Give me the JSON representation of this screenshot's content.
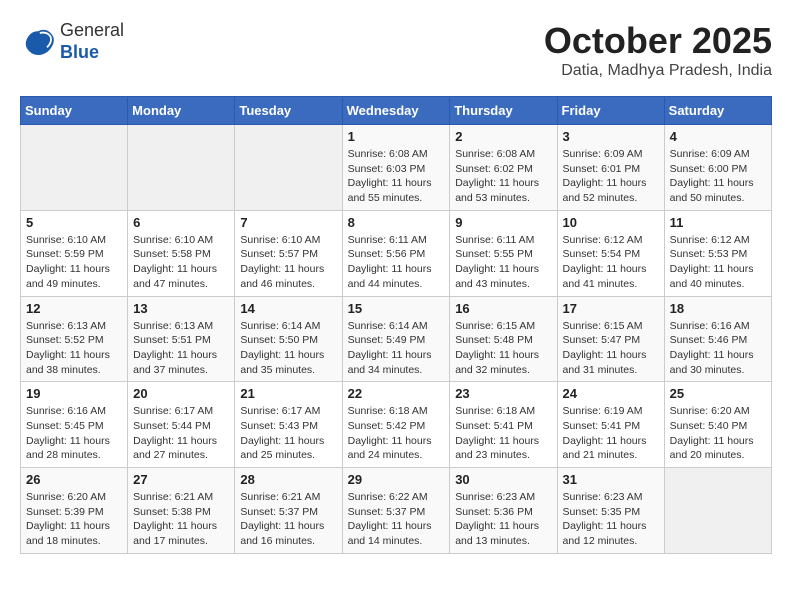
{
  "header": {
    "logo_line1": "General",
    "logo_line2": "Blue",
    "month": "October 2025",
    "location": "Datia, Madhya Pradesh, India"
  },
  "weekdays": [
    "Sunday",
    "Monday",
    "Tuesday",
    "Wednesday",
    "Thursday",
    "Friday",
    "Saturday"
  ],
  "weeks": [
    [
      {
        "day": "",
        "info": ""
      },
      {
        "day": "",
        "info": ""
      },
      {
        "day": "",
        "info": ""
      },
      {
        "day": "1",
        "info": "Sunrise: 6:08 AM\nSunset: 6:03 PM\nDaylight: 11 hours\nand 55 minutes."
      },
      {
        "day": "2",
        "info": "Sunrise: 6:08 AM\nSunset: 6:02 PM\nDaylight: 11 hours\nand 53 minutes."
      },
      {
        "day": "3",
        "info": "Sunrise: 6:09 AM\nSunset: 6:01 PM\nDaylight: 11 hours\nand 52 minutes."
      },
      {
        "day": "4",
        "info": "Sunrise: 6:09 AM\nSunset: 6:00 PM\nDaylight: 11 hours\nand 50 minutes."
      }
    ],
    [
      {
        "day": "5",
        "info": "Sunrise: 6:10 AM\nSunset: 5:59 PM\nDaylight: 11 hours\nand 49 minutes."
      },
      {
        "day": "6",
        "info": "Sunrise: 6:10 AM\nSunset: 5:58 PM\nDaylight: 11 hours\nand 47 minutes."
      },
      {
        "day": "7",
        "info": "Sunrise: 6:10 AM\nSunset: 5:57 PM\nDaylight: 11 hours\nand 46 minutes."
      },
      {
        "day": "8",
        "info": "Sunrise: 6:11 AM\nSunset: 5:56 PM\nDaylight: 11 hours\nand 44 minutes."
      },
      {
        "day": "9",
        "info": "Sunrise: 6:11 AM\nSunset: 5:55 PM\nDaylight: 11 hours\nand 43 minutes."
      },
      {
        "day": "10",
        "info": "Sunrise: 6:12 AM\nSunset: 5:54 PM\nDaylight: 11 hours\nand 41 minutes."
      },
      {
        "day": "11",
        "info": "Sunrise: 6:12 AM\nSunset: 5:53 PM\nDaylight: 11 hours\nand 40 minutes."
      }
    ],
    [
      {
        "day": "12",
        "info": "Sunrise: 6:13 AM\nSunset: 5:52 PM\nDaylight: 11 hours\nand 38 minutes."
      },
      {
        "day": "13",
        "info": "Sunrise: 6:13 AM\nSunset: 5:51 PM\nDaylight: 11 hours\nand 37 minutes."
      },
      {
        "day": "14",
        "info": "Sunrise: 6:14 AM\nSunset: 5:50 PM\nDaylight: 11 hours\nand 35 minutes."
      },
      {
        "day": "15",
        "info": "Sunrise: 6:14 AM\nSunset: 5:49 PM\nDaylight: 11 hours\nand 34 minutes."
      },
      {
        "day": "16",
        "info": "Sunrise: 6:15 AM\nSunset: 5:48 PM\nDaylight: 11 hours\nand 32 minutes."
      },
      {
        "day": "17",
        "info": "Sunrise: 6:15 AM\nSunset: 5:47 PM\nDaylight: 11 hours\nand 31 minutes."
      },
      {
        "day": "18",
        "info": "Sunrise: 6:16 AM\nSunset: 5:46 PM\nDaylight: 11 hours\nand 30 minutes."
      }
    ],
    [
      {
        "day": "19",
        "info": "Sunrise: 6:16 AM\nSunset: 5:45 PM\nDaylight: 11 hours\nand 28 minutes."
      },
      {
        "day": "20",
        "info": "Sunrise: 6:17 AM\nSunset: 5:44 PM\nDaylight: 11 hours\nand 27 minutes."
      },
      {
        "day": "21",
        "info": "Sunrise: 6:17 AM\nSunset: 5:43 PM\nDaylight: 11 hours\nand 25 minutes."
      },
      {
        "day": "22",
        "info": "Sunrise: 6:18 AM\nSunset: 5:42 PM\nDaylight: 11 hours\nand 24 minutes."
      },
      {
        "day": "23",
        "info": "Sunrise: 6:18 AM\nSunset: 5:41 PM\nDaylight: 11 hours\nand 23 minutes."
      },
      {
        "day": "24",
        "info": "Sunrise: 6:19 AM\nSunset: 5:41 PM\nDaylight: 11 hours\nand 21 minutes."
      },
      {
        "day": "25",
        "info": "Sunrise: 6:20 AM\nSunset: 5:40 PM\nDaylight: 11 hours\nand 20 minutes."
      }
    ],
    [
      {
        "day": "26",
        "info": "Sunrise: 6:20 AM\nSunset: 5:39 PM\nDaylight: 11 hours\nand 18 minutes."
      },
      {
        "day": "27",
        "info": "Sunrise: 6:21 AM\nSunset: 5:38 PM\nDaylight: 11 hours\nand 17 minutes."
      },
      {
        "day": "28",
        "info": "Sunrise: 6:21 AM\nSunset: 5:37 PM\nDaylight: 11 hours\nand 16 minutes."
      },
      {
        "day": "29",
        "info": "Sunrise: 6:22 AM\nSunset: 5:37 PM\nDaylight: 11 hours\nand 14 minutes."
      },
      {
        "day": "30",
        "info": "Sunrise: 6:23 AM\nSunset: 5:36 PM\nDaylight: 11 hours\nand 13 minutes."
      },
      {
        "day": "31",
        "info": "Sunrise: 6:23 AM\nSunset: 5:35 PM\nDaylight: 11 hours\nand 12 minutes."
      },
      {
        "day": "",
        "info": ""
      }
    ]
  ]
}
